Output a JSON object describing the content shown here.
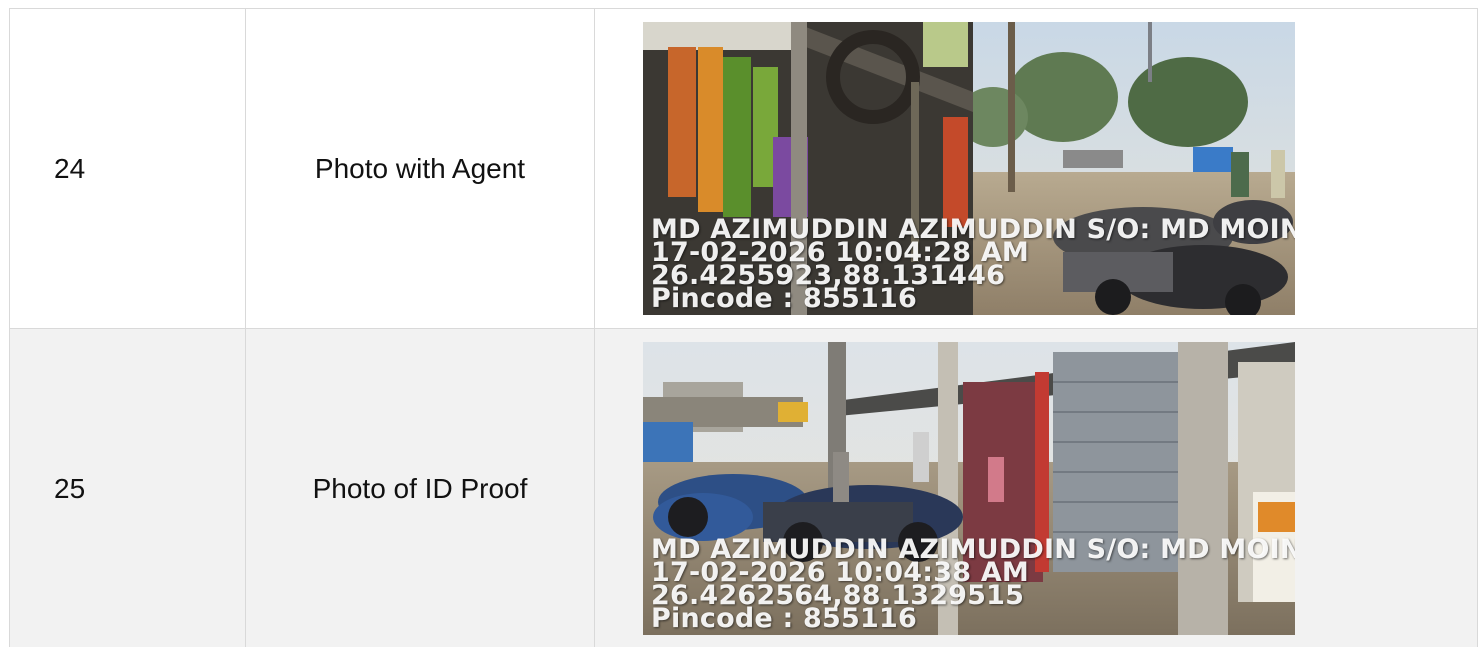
{
  "rows": [
    {
      "serial": "24",
      "label": "Photo with Agent",
      "photo": {
        "subject": "shop-front-with-motorcycles",
        "overlay": {
          "name": "MD AZIMUDDIN AZIMUDDIN S/O: MD MOIN",
          "datetime": "17-02-2026 10:04:28 AM",
          "coords": "26.4255923,88.131446",
          "pincode": "Pincode : 855116"
        }
      }
    },
    {
      "serial": "25",
      "label": "Photo of ID Proof",
      "photo": {
        "subject": "shuttered-shops-with-parked-bikes",
        "overlay": {
          "name": "MD AZIMUDDIN AZIMUDDIN S/O: MD MOIN",
          "datetime": "17-02-2026 10:04:38 AM",
          "coords": "26.4262564,88.1329515",
          "pincode": "Pincode : 855116"
        }
      }
    }
  ],
  "colors": {
    "border": "#d9d9d9",
    "alt_row": "#f2f2f2",
    "text": "#111111"
  }
}
